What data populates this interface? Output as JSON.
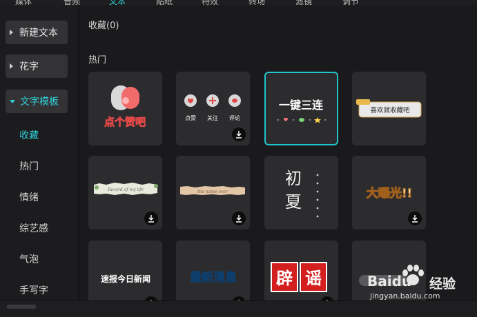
{
  "top_tabs": [
    "媒体",
    "音频",
    "文本",
    "贴纸",
    "特效",
    "转场",
    "滤镜",
    "调节"
  ],
  "active_top_tab": 2,
  "sidebar": {
    "buttons": [
      {
        "label": "新建文本"
      },
      {
        "label": "花字"
      },
      {
        "label": "文字模板"
      }
    ],
    "subitems": [
      {
        "label": "收藏"
      },
      {
        "label": "热门"
      },
      {
        "label": "情绪"
      },
      {
        "label": "综艺感"
      },
      {
        "label": "气泡"
      },
      {
        "label": "手写字"
      }
    ]
  },
  "main": {
    "favorites_title": "收藏(0)",
    "hot_title": "热门",
    "cards": [
      {
        "name": "like-template",
        "text": "点个赞吧"
      },
      {
        "name": "like-follow-comment-template",
        "labels": [
          "点赞",
          "关注",
          "评论"
        ]
      },
      {
        "name": "triple-template",
        "text": "一键三连"
      },
      {
        "name": "favorite-tag-template",
        "text": "喜欢就收藏吧"
      },
      {
        "name": "paper-strip-template",
        "text": "Record of my life"
      },
      {
        "name": "torn-paper-template",
        "text": "the name ever"
      },
      {
        "name": "early-summer-template",
        "text": "初夏"
      },
      {
        "name": "exposure-template",
        "text": "大曝光!!"
      },
      {
        "name": "news-template",
        "text": "速报今日新闻"
      },
      {
        "name": "latest-news-template",
        "text": "最新消息"
      },
      {
        "name": "rumor-template",
        "chars": [
          "辟",
          "谣"
        ]
      },
      {
        "name": "blank-template"
      }
    ]
  },
  "watermark": {
    "brand": "Baidu",
    "brand_cn": "经验",
    "url": "jingyan.baidu.com"
  },
  "colors": {
    "accent": "#2fd1d7",
    "card_bg": "#2c2c2e",
    "selected_border": "#20c4cc"
  }
}
